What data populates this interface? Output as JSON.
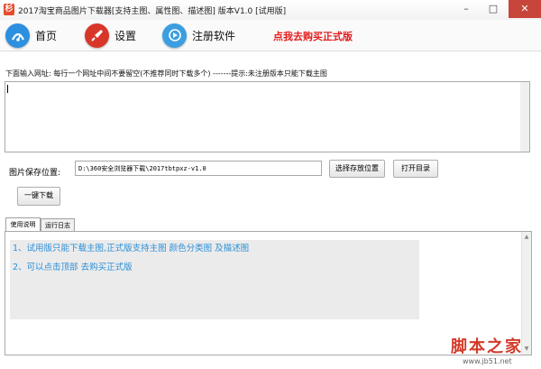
{
  "window": {
    "title": "2017淘宝商品图片下载器[支持主图、属性图、描述图] 版本V1.0 [试用版]",
    "app_icon_glyph": "杉"
  },
  "toolbar": {
    "items": [
      {
        "label": "首页",
        "icon": "home-icon",
        "color": "#2d8fe0"
      },
      {
        "label": "设置",
        "icon": "rocket-icon",
        "color": "#d9362a"
      },
      {
        "label": "注册软件",
        "icon": "register-icon",
        "color": "#3b9ee0"
      }
    ],
    "promo": "点我去购买正式版"
  },
  "input_section": {
    "hint": "下面输入网址:   每行一个网址中间不要留空(不推荐同时下载多个)   -------提示:未注册版本只能下载主图",
    "url_value": ""
  },
  "save": {
    "label": "图片保存位置:",
    "path": "D:\\360安全浏览器下载\\2017tbtpxz-v1.0",
    "choose_button": "选择存放位置",
    "open_button": "打开目录"
  },
  "download_button": "一键下载",
  "tabs": [
    "使用说明",
    "运行日志"
  ],
  "instructions": [
    "1、试用版只能下载主图,正式版支持主图 颜色分类图 及描述图",
    "2、可以点击顶部 去购买正式版"
  ],
  "watermark": {
    "main": "脚本之家",
    "sub": "www.jb51.net"
  },
  "colors": {
    "promo": "#e41b1b",
    "instruction_text": "#2a8fd8",
    "close_button": "#c7453a"
  }
}
